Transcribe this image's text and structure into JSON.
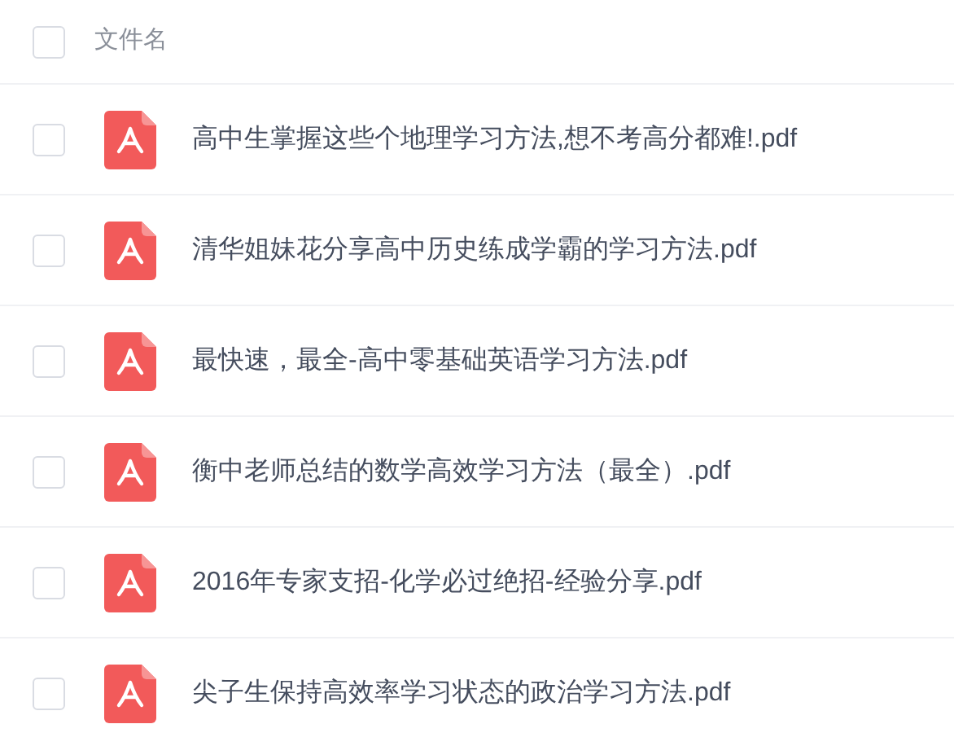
{
  "header": {
    "checked": false,
    "column": "文件名"
  },
  "files": [
    {
      "name": "高中生掌握这些个地理学习方法,想不考高分都难!.pdf",
      "checked": false
    },
    {
      "name": "清华姐妹花分享高中历史练成学霸的学习方法.pdf",
      "checked": false
    },
    {
      "name": "最快速，最全-高中零基础英语学习方法.pdf",
      "checked": false
    },
    {
      "name": "衡中老师总结的数学高效学习方法（最全）.pdf",
      "checked": false
    },
    {
      "name": "2016年专家支招-化学必过绝招-经验分享.pdf",
      "checked": false
    },
    {
      "name": "尖子生保持高效率学习状态的政治学习方法.pdf",
      "checked": false
    }
  ]
}
